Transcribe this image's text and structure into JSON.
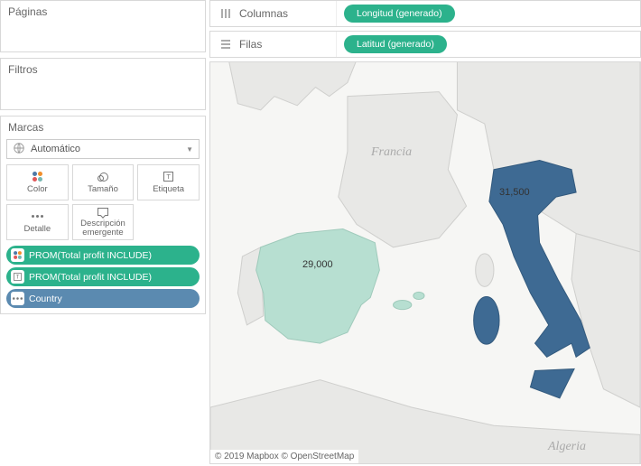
{
  "sidebar": {
    "pages_title": "Páginas",
    "filters_title": "Filtros",
    "marks_title": "Marcas",
    "mark_type": "Automático",
    "mark_buttons": {
      "color": "Color",
      "size": "Tamaño",
      "label": "Etiqueta",
      "detail": "Detalle",
      "tooltip": "Descripción emergente"
    },
    "pills": [
      {
        "icon": "color",
        "text": "PROM(Total profit INCLUDE)",
        "class": "pill-green"
      },
      {
        "icon": "label",
        "text": "PROM(Total profit INCLUDE)",
        "class": "pill-green"
      },
      {
        "icon": "detail",
        "text": "Country",
        "class": "pill-blue"
      }
    ]
  },
  "shelves": {
    "columns_label": "Columnas",
    "columns_pill": "Longitud (generado)",
    "rows_label": "Filas",
    "rows_pill": "Latitud (generado)"
  },
  "map": {
    "attribution": "© 2019 Mapbox © OpenStreetMap",
    "country_labels": {
      "france": "Francia",
      "algeria": "Algeria"
    },
    "highlighted": [
      {
        "country": "Spain",
        "value_text": "29,000",
        "color": "#b7dfd1"
      },
      {
        "country": "Italy",
        "value_text": "31,500",
        "color": "#3e6a93"
      }
    ]
  },
  "chart_data": {
    "type": "map",
    "title": "",
    "geo_field": "Country",
    "measure": "PROM(Total profit INCLUDE)",
    "series": [
      {
        "country": "Spain",
        "value": 29000
      },
      {
        "country": "Italy",
        "value": 31500
      }
    ],
    "color_scale": {
      "min_color": "#b7dfd1",
      "max_color": "#3e6a93"
    }
  }
}
